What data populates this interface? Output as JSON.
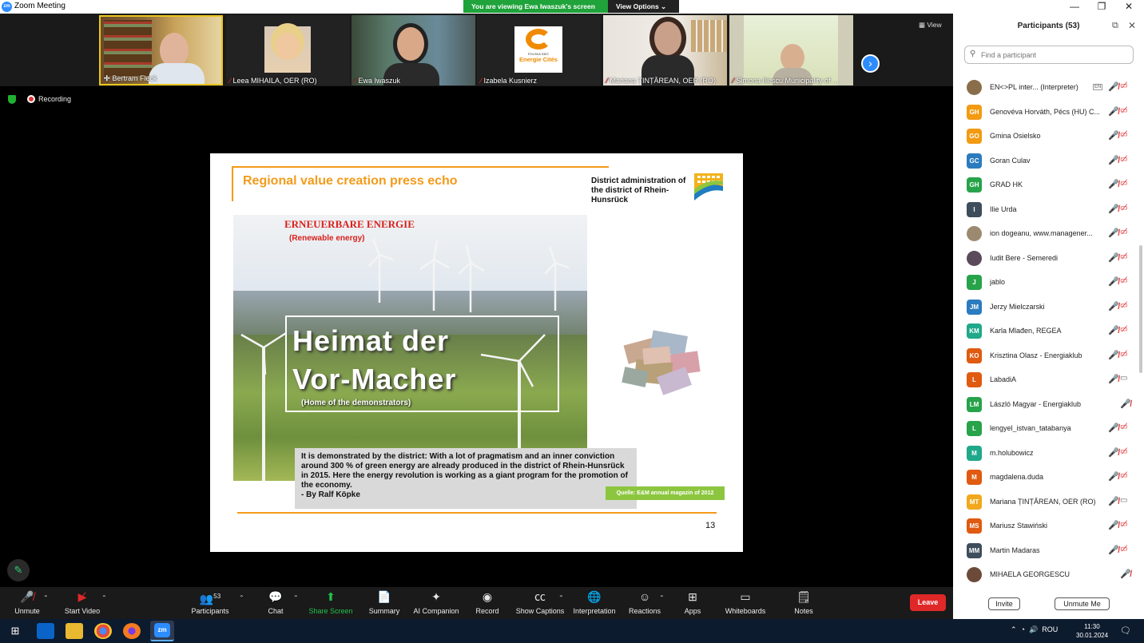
{
  "window": {
    "app_icon": "zm",
    "title": "Zoom Meeting",
    "minimize": "—",
    "restore": "❐",
    "close": "✕"
  },
  "banner": {
    "message": "You are viewing Ewa Iwaszuk's screen",
    "options": "View Options ⌄"
  },
  "video_tiles": [
    {
      "name": "Bertram Fleck"
    },
    {
      "name": "Leea MIHAILA, OER (RO)"
    },
    {
      "name": "Ewa Iwaszuk"
    },
    {
      "name": "Izabela Kusnierz"
    },
    {
      "name": "Mariana ȚINȚĂREAN, OER (RO)"
    },
    {
      "name": "Simona Iliescu Municipality of ..."
    }
  ],
  "tile_logo": {
    "org": "POLSKA SIEĆ",
    "name": "Energie Cités"
  },
  "view_button": "View",
  "recording": {
    "label": "Recording"
  },
  "slide": {
    "title": "Regional value creation press echo",
    "district": "District administration of the district of Rhein-Hunsrück",
    "magazine_title": "ERNEUERBARE ENERGIE",
    "magazine_sub": "(Renewable energy)",
    "heading_line1": "Heimat der",
    "heading_line2": "Vor-Macher",
    "heading_sub": "(Home of the demonstrators)",
    "quote": "It is demonstrated by the district: With a lot of pragmatism and an inner conviction around 300 % of green energy are already produced in the district of Rhein-Hunsrück in 2015. Here the energy revolution is working as a giant program for the promotion of the economy.",
    "quote_author": "- By Ralf Köpke",
    "source": "Quelle:  E&M annual magazin of 2012",
    "page_number": "13"
  },
  "toolbar": {
    "unmute": "Unmute",
    "start_video": "Start Video",
    "participants": "Participants",
    "participants_count": "53",
    "chat": "Chat",
    "share_screen": "Share Screen",
    "summary": "Summary",
    "ai_companion": "AI Companion",
    "record": "Record",
    "show_captions": "Show Captions",
    "interpretation": "Interpretation",
    "reactions": "Reactions",
    "apps": "Apps",
    "whiteboards": "Whiteboards",
    "notes": "Notes",
    "leave": "Leave"
  },
  "panel": {
    "title": "Participants (53)",
    "search_placeholder": "Find a participant",
    "invite": "Invite",
    "unmute_me": "Unmute Me",
    "participants": [
      {
        "initials": "",
        "name": "EN<>PL inter... (Interpreter)",
        "color": "#8a6d4a",
        "tag": "EN",
        "mic": "off",
        "video": "off"
      },
      {
        "initials": "GH",
        "name": "Genovéva Horváth, Pécs (HU) C...",
        "color": "#f29a12",
        "mic": "off",
        "video": "off"
      },
      {
        "initials": "GO",
        "name": "Gmina Osielsko",
        "color": "#f29a12",
        "mic": "off",
        "video": "off"
      },
      {
        "initials": "GC",
        "name": "Goran Culav",
        "color": "#2b7bbf",
        "mic": "off",
        "video": "off"
      },
      {
        "initials": "GH",
        "name": "GRAD HK",
        "color": "#27a34a",
        "mic": "off",
        "video": "off"
      },
      {
        "initials": "I",
        "name": "Ilie Urda",
        "color": "#3e4d5c",
        "mic": "off",
        "video": "off"
      },
      {
        "initials": "",
        "name": "ion dogeanu, www.managener...",
        "color": "#9c8a70",
        "mic": "off",
        "video": "off"
      },
      {
        "initials": "",
        "name": "Iudit Bere - Semeredi",
        "color": "#5a4a5a",
        "mic": "off",
        "video": "off"
      },
      {
        "initials": "J",
        "name": "jablo",
        "color": "#27a34a",
        "mic": "off",
        "video": "off"
      },
      {
        "initials": "JM",
        "name": "Jerzy Mielczarski",
        "color": "#2b7bbf",
        "mic": "off",
        "video": "off"
      },
      {
        "initials": "KM",
        "name": "Karla Mlađen, REGEA",
        "color": "#1fa88a",
        "mic": "off",
        "video": "off"
      },
      {
        "initials": "KO",
        "name": "Krisztina Olasz - Energiaklub",
        "color": "#e05a10",
        "mic": "off",
        "video": "off"
      },
      {
        "initials": "L",
        "name": "LabadiA",
        "color": "#e05a10",
        "mic": "off",
        "video": "on"
      },
      {
        "initials": "LM",
        "name": "László Magyar - Energiaklub",
        "color": "#27a34a",
        "mic": "off",
        "video": "none"
      },
      {
        "initials": "L",
        "name": "lengyel_istvan_tatabanya",
        "color": "#27a34a",
        "mic": "off",
        "video": "off"
      },
      {
        "initials": "M",
        "name": "m.holubowicz",
        "color": "#1fa88a",
        "mic": "off",
        "video": "off"
      },
      {
        "initials": "M",
        "name": "magdalena.duda",
        "color": "#e05a10",
        "mic": "off",
        "video": "off"
      },
      {
        "initials": "MT",
        "name": "Mariana ȚINȚĂREAN, OER (RO)",
        "color": "#f2a81c",
        "mic": "off",
        "video": "on"
      },
      {
        "initials": "MS",
        "name": "Mariusz Stawiński",
        "color": "#e05a10",
        "mic": "off",
        "video": "off"
      },
      {
        "initials": "MM",
        "name": "Martin Madaras",
        "color": "#3e4d5c",
        "mic": "off",
        "video": "off"
      },
      {
        "initials": "",
        "name": "MIHAELA GEORGESCU",
        "color": "#6b4a3a",
        "mic": "off",
        "video": "none"
      }
    ]
  },
  "taskbar": {
    "lang": "ROU",
    "time": "11:30",
    "date": "30.01.2024"
  },
  "colors": {
    "zoom_blue": "#2d8cff",
    "banner_green": "#1fa33a",
    "accent_orange": "#f39b1a",
    "leave_red": "#e02828"
  }
}
